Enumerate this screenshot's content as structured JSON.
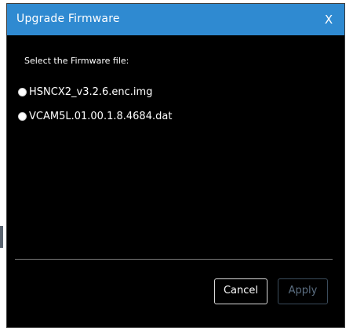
{
  "dialog": {
    "title": "Upgrade Firmware",
    "close_label": "X",
    "prompt": "Select the Firmware file:",
    "options": [
      {
        "label": "HSNCX2_v3.2.6.enc.img",
        "selected": false
      },
      {
        "label": "VCAM5L.01.00.1.8.4684.dat",
        "selected": false
      }
    ],
    "buttons": {
      "cancel_label": "Cancel",
      "apply_label": "Apply",
      "apply_enabled": false
    }
  },
  "colors": {
    "title_bar": "#2f8ad1",
    "dialog_bg": "#000000",
    "text": "#ffffff",
    "disabled_text": "#5c6f82"
  }
}
